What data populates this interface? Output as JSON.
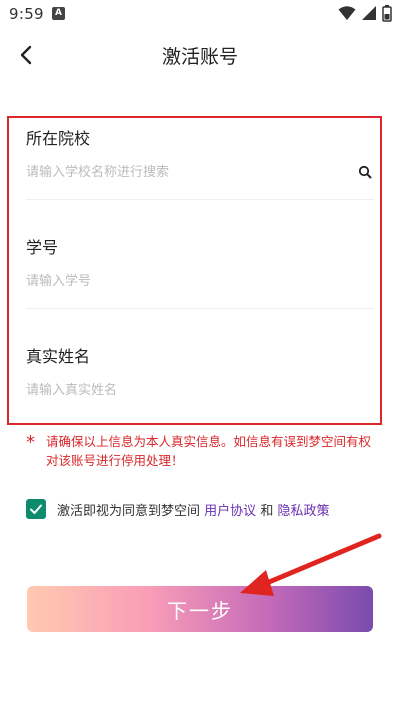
{
  "status_bar": {
    "time": "9:59",
    "notification_badge": "A"
  },
  "header": {
    "title": "激活账号"
  },
  "form": {
    "school": {
      "label": "所在院校",
      "placeholder": "请输入学校名称进行搜索"
    },
    "student_id": {
      "label": "学号",
      "placeholder": "请输入学号"
    },
    "real_name": {
      "label": "真实姓名",
      "placeholder": "请输入真实姓名"
    }
  },
  "warning": {
    "star": "*",
    "text": "请确保以上信息为本人真实信息。如信息有误到梦空间有权对该账号进行停用处理！"
  },
  "agreement": {
    "checked": true,
    "prefix": "激活即视为同意到梦空间",
    "user_agreement": "用户协议",
    "and": "和",
    "privacy_policy": "隐私政策"
  },
  "next_button": {
    "label": "下一步"
  },
  "colors": {
    "highlight_border": "#d9272a",
    "warning_text": "#d9272a",
    "checkbox": "#0e8a6c",
    "link": "#6b2fb0",
    "button_gradient": [
      "#ffcab0",
      "#f99db7",
      "#c46ab8",
      "#7a4bae"
    ]
  },
  "icons": [
    "back-arrow-icon",
    "search-icon",
    "check-icon",
    "wifi-icon",
    "signal-icon",
    "battery-icon"
  ]
}
